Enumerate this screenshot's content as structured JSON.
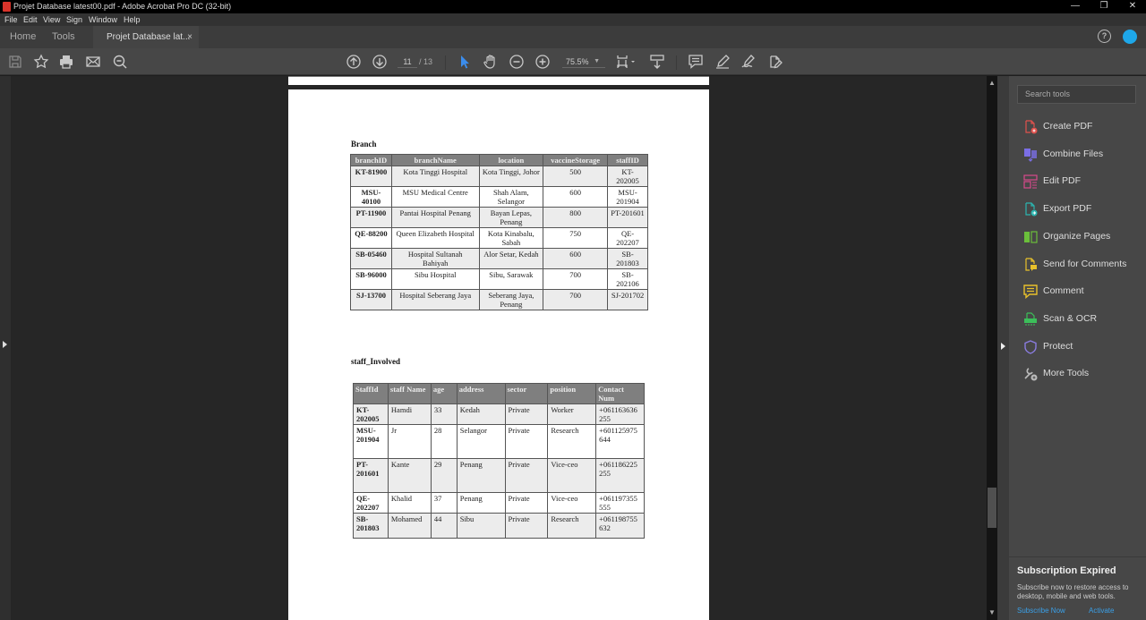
{
  "window": {
    "title": "Projet Database latest00.pdf - Adobe Acrobat Pro DC (32-bit)",
    "controls": {
      "minimize": "—",
      "restore": "❐",
      "close": "✕"
    }
  },
  "menu": [
    "File",
    "Edit",
    "View",
    "Sign",
    "Window",
    "Help"
  ],
  "tabs": {
    "home": "Home",
    "tools": "Tools",
    "document": "Projet Database lat...",
    "close": "×"
  },
  "header_icons": {
    "help": "?"
  },
  "toolbar": {
    "current_page": "11",
    "total_pages": "/ 13",
    "zoom": "75.5%",
    "zoom_caret": "▼"
  },
  "document": {
    "branch": {
      "title": "Branch",
      "headers": [
        "branchID",
        "branchName",
        "location",
        "vaccineStorage",
        "staffID"
      ],
      "rows": [
        [
          "KT-81900",
          "Kota Tinggi Hospital",
          "Kota Tinggi, Johor",
          "500",
          "KT-202005"
        ],
        [
          "MSU-40100",
          "MSU Medical Centre",
          "Shah Alam, Selangor",
          "600",
          "MSU-201904"
        ],
        [
          "PT-11900",
          "Pantai Hospital Penang",
          "Bayan Lepas, Penang",
          "800",
          "PT-201601"
        ],
        [
          "QE-88200",
          "Queen Elizabeth Hospital",
          "Kota Kinabalu, Sabah",
          "750",
          "QE-202207"
        ],
        [
          "SB-05460",
          "Hospital Sultanah Bahiyah",
          "Alor Setar, Kedah",
          "600",
          "SB-201803"
        ],
        [
          "SB-96000",
          "Sibu Hospital",
          "Sibu, Sarawak",
          "700",
          "SB-202106"
        ],
        [
          "SJ-13700",
          "Hospital Seberang Jaya",
          "Seberang Jaya, Penang",
          "700",
          "SJ-201702"
        ]
      ]
    },
    "staff": {
      "title": "staff_Involved",
      "headers": [
        "StaffId",
        "staff Name",
        "age",
        "address",
        "sector",
        "position",
        "Contact Num"
      ],
      "rows": [
        [
          "KT-202005",
          "Hamdi",
          "33",
          "Kedah",
          "Private",
          "Worker",
          "+061163636255"
        ],
        [
          "MSU-201904",
          "Jr",
          "28",
          "Selangor",
          "Private",
          "Research",
          "+601125975644"
        ],
        [
          "PT-201601",
          "Kante",
          "29",
          "Penang",
          "Private",
          "Vice-ceo",
          "+061186225255"
        ],
        [
          "QE-202207",
          "Khalid",
          "37",
          "Penang",
          "Private",
          "Vice-ceo",
          "+061197355555"
        ],
        [
          "SB-201803",
          "Mohamed",
          "44",
          "Sibu",
          "Private",
          "Research",
          "+061198755632"
        ]
      ]
    }
  },
  "right_panel": {
    "search_placeholder": "Search tools",
    "tools": [
      {
        "label": "Create PDF",
        "icon": "create-pdf-icon",
        "color": "#e0524d"
      },
      {
        "label": "Combine Files",
        "icon": "combine-files-icon",
        "color": "#7b6ee6"
      },
      {
        "label": "Edit PDF",
        "icon": "edit-pdf-icon",
        "color": "#d84a8c"
      },
      {
        "label": "Export PDF",
        "icon": "export-pdf-icon",
        "color": "#2bb5b0"
      },
      {
        "label": "Organize Pages",
        "icon": "organize-pages-icon",
        "color": "#6bbf3b"
      },
      {
        "label": "Send for Comments",
        "icon": "send-for-comments-icon",
        "color": "#e8c12b"
      },
      {
        "label": "Comment",
        "icon": "comment-icon",
        "color": "#e8c12b"
      },
      {
        "label": "Scan & OCR",
        "icon": "scan-ocr-icon",
        "color": "#3cbf5a"
      },
      {
        "label": "Protect",
        "icon": "protect-icon",
        "color": "#8a7ce0"
      },
      {
        "label": "More Tools",
        "icon": "more-tools-icon",
        "color": "#bbbbbb"
      }
    ],
    "subscription": {
      "title": "Subscription Expired",
      "text": "Subscribe now to restore access to desktop, mobile and web tools.",
      "subscribe_link": "Subscribe Now",
      "activate_link": "Activate"
    }
  }
}
